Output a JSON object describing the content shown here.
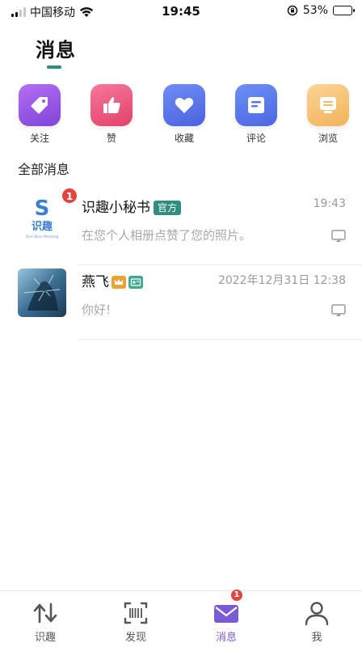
{
  "status_bar": {
    "carrier": "中国移动",
    "time": "19:45",
    "battery": "53%",
    "battery_level": 0.53
  },
  "page_title": "消息",
  "shortcuts": [
    {
      "label": "关注",
      "icon": "tag-icon",
      "color_top": "#b56ef2",
      "color_bottom": "#7f44d9"
    },
    {
      "label": "赞",
      "icon": "thumbs-up-icon",
      "color_top": "#f5789a",
      "color_bottom": "#e4416a"
    },
    {
      "label": "收藏",
      "icon": "heart-icon",
      "color_top": "#6f8df5",
      "color_bottom": "#4a62de"
    },
    {
      "label": "评论",
      "icon": "comment-icon",
      "color_top": "#6d8ff6",
      "color_bottom": "#4c67e2"
    },
    {
      "label": "浏览",
      "icon": "browse-icon",
      "color_top": "#fbd593",
      "color_bottom": "#f2b25c"
    }
  ],
  "section_label": "全部消息",
  "messages": [
    {
      "name": "识趣小秘书",
      "tag": "官方",
      "time": "19:43",
      "preview": "在您个人相册点赞了您的照片。",
      "unread": "1",
      "avatar": {
        "letter": "S",
        "text": "识趣",
        "subtext": "One Slice Meeting"
      }
    },
    {
      "name": "燕飞",
      "time": "2022年12月31日 12:38",
      "preview": "你好!"
    }
  ],
  "tabbar": {
    "tabs": [
      {
        "label": "识趣",
        "icon": "swap-arrows-icon"
      },
      {
        "label": "发现",
        "icon": "barcode-scan-icon"
      },
      {
        "label": "消息",
        "icon": "mail-icon",
        "badge": "1"
      },
      {
        "label": "我",
        "icon": "person-icon"
      }
    ],
    "active_color": "#7b5ad6"
  }
}
